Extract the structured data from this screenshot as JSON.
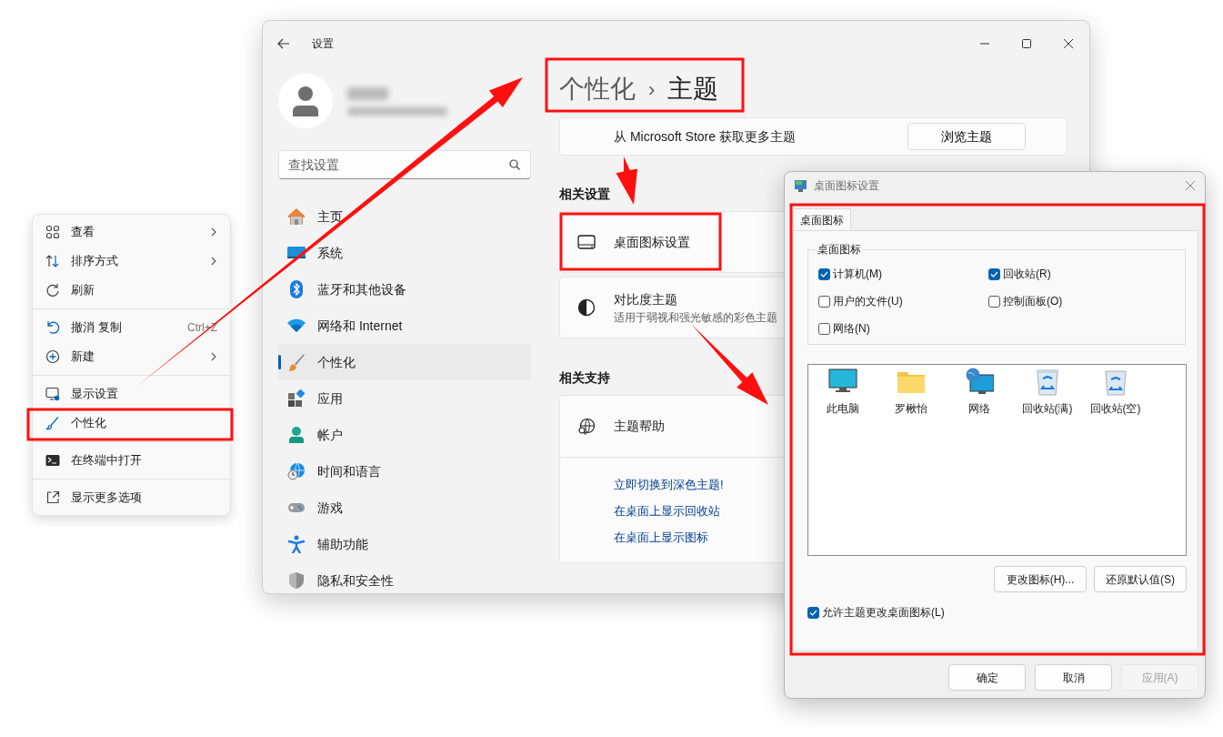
{
  "context_menu": {
    "sections": [
      [
        {
          "label": "查看",
          "submenu": true
        },
        {
          "label": "排序方式",
          "submenu": true
        },
        {
          "label": "刷新",
          "submenu": false
        }
      ],
      [
        {
          "label": "撤消 复制",
          "shortcut": "Ctrl+Z",
          "submenu": false
        },
        {
          "label": "新建",
          "submenu": true
        }
      ],
      [
        {
          "label": "显示设置",
          "submenu": false
        },
        {
          "label": "个性化",
          "submenu": false
        }
      ],
      [
        {
          "label": "在终端中打开",
          "submenu": false
        }
      ],
      [
        {
          "label": "显示更多选项",
          "submenu": false
        }
      ]
    ]
  },
  "settings": {
    "window": {
      "title": "设置"
    },
    "search": {
      "placeholder": "查找设置"
    },
    "nav": [
      {
        "label": "主页",
        "selected": false
      },
      {
        "label": "系统",
        "selected": false
      },
      {
        "label": "蓝牙和其他设备",
        "selected": false
      },
      {
        "label": "网络和 Internet",
        "selected": false
      },
      {
        "label": "个性化",
        "selected": true
      },
      {
        "label": "应用",
        "selected": false
      },
      {
        "label": "帐户",
        "selected": false
      },
      {
        "label": "时间和语言",
        "selected": false
      },
      {
        "label": "游戏",
        "selected": false
      },
      {
        "label": "辅助功能",
        "selected": false
      },
      {
        "label": "隐私和安全性",
        "selected": false
      }
    ],
    "breadcrumb": {
      "parent": "个性化",
      "separator": "›",
      "current": "主题"
    },
    "store_card": {
      "text": "从 Microsoft Store 获取更多主题",
      "button": "浏览主题"
    },
    "related_settings": {
      "heading": "相关设置",
      "items": [
        {
          "title": "桌面图标设置"
        },
        {
          "title": "对比度主题",
          "subtitle": "适用于弱视和强光敏感的彩色主题"
        }
      ]
    },
    "related_support": {
      "heading": "相关支持",
      "title": "主题帮助",
      "links": [
        "立即切换到深色主题!",
        "在桌面上显示回收站",
        "在桌面上显示图标"
      ]
    }
  },
  "dialog": {
    "title": "桌面图标设置",
    "tabs": [
      {
        "label": "桌面图标",
        "selected": true
      }
    ],
    "group": {
      "legend": "桌面图标",
      "checkboxes": [
        {
          "label": "计算机(M)",
          "checked": true
        },
        {
          "label": "回收站(R)",
          "checked": true
        },
        {
          "label": "用户的文件(U)",
          "checked": false
        },
        {
          "label": "控制面板(O)",
          "checked": false
        },
        {
          "label": "网络(N)",
          "checked": false
        }
      ]
    },
    "preview_icons": [
      {
        "label": "此电脑"
      },
      {
        "label": "罗楸怡"
      },
      {
        "label": "网络"
      },
      {
        "label": "回收站(满)"
      },
      {
        "label": "回收站(空)"
      }
    ],
    "icon_buttons": [
      "更改图标(H)...",
      "还原默认值(S)"
    ],
    "allow_theme": {
      "label": "允许主题更改桌面图标(L)",
      "checked": true
    },
    "footer_buttons": [
      {
        "label": "确定",
        "disabled": false
      },
      {
        "label": "取消",
        "disabled": false
      },
      {
        "label": "应用(A)",
        "disabled": true
      }
    ]
  }
}
